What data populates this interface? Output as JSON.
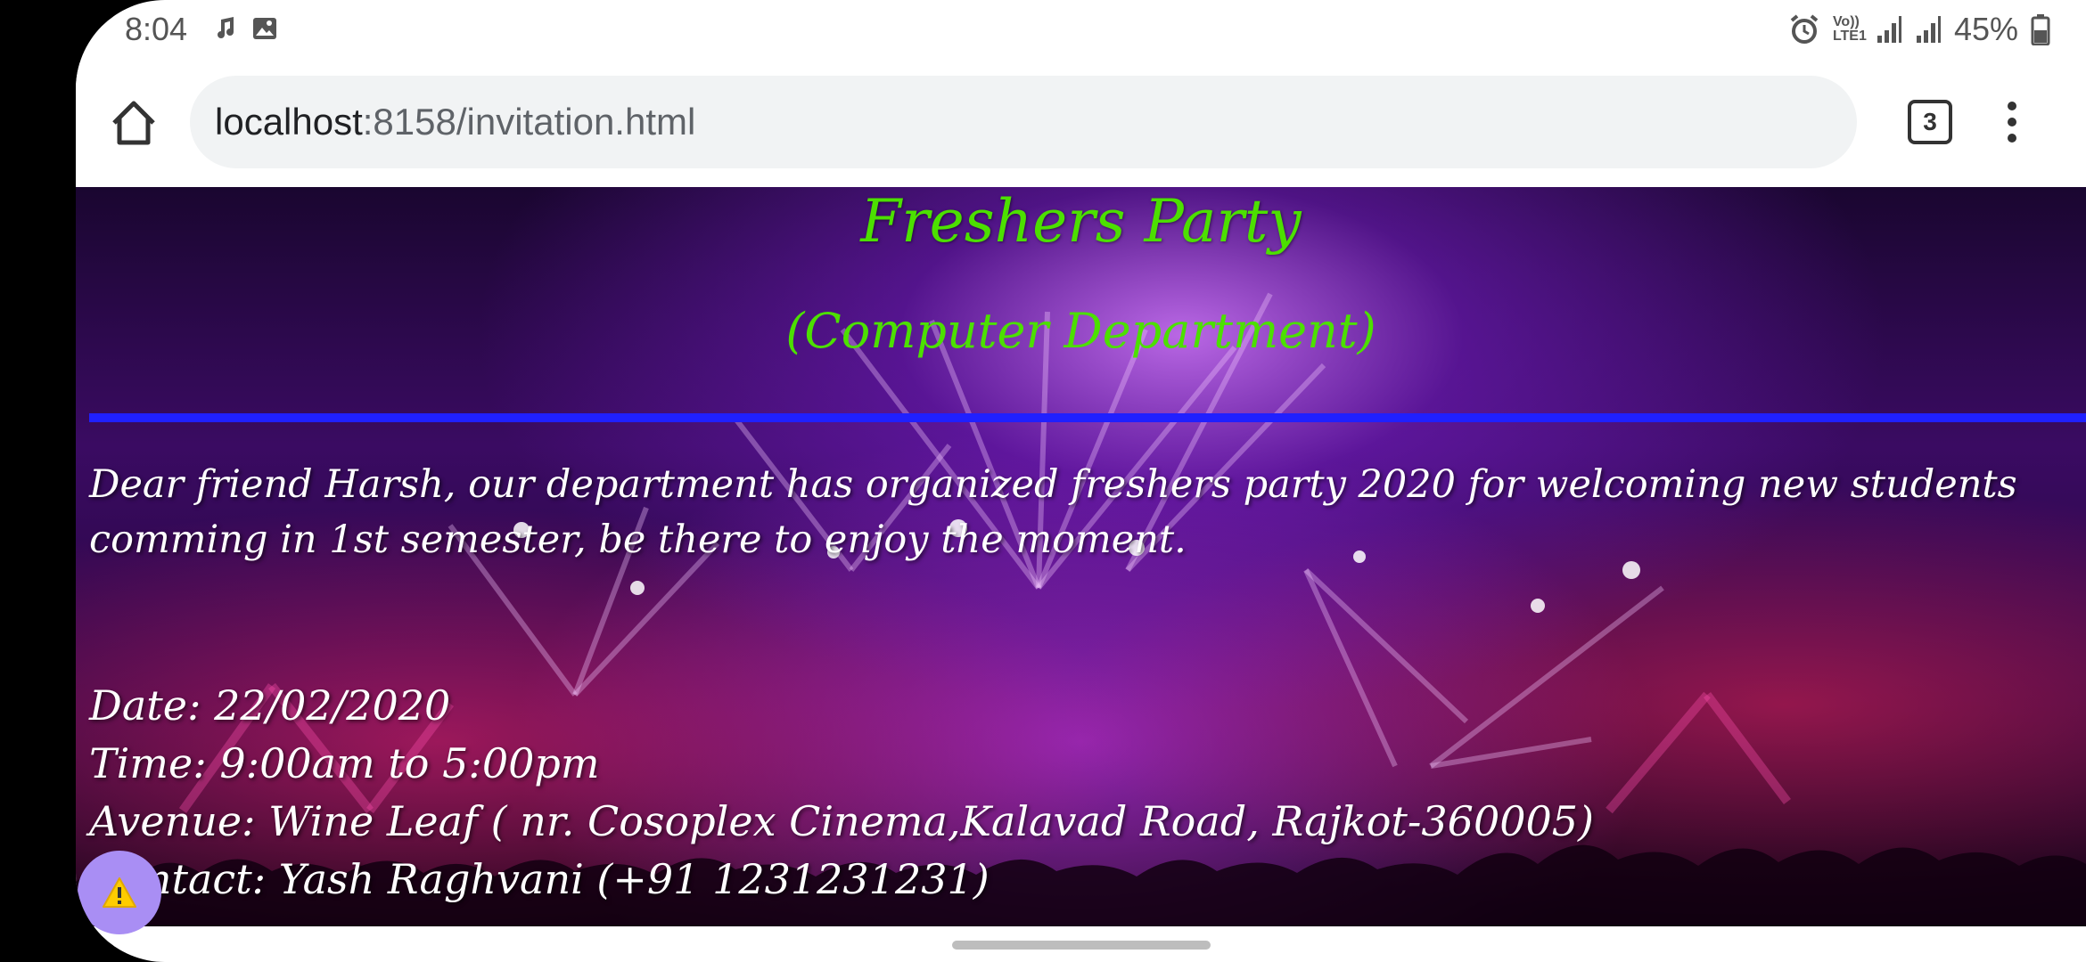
{
  "status_bar": {
    "time": "8:04",
    "left_icons": [
      "music-note-icon",
      "image-icon"
    ],
    "right_icons": [
      "alarm-icon",
      "volte-icon",
      "signal-icon",
      "signal-icon",
      "battery-icon"
    ],
    "network_label": "Vo)) LTE1",
    "battery": "45%"
  },
  "browser": {
    "url_host": "localhost",
    "url_path": ":8158/invitation.html",
    "tab_count": "3",
    "home_icon": "home-icon",
    "menu_icon": "more-vertical-icon"
  },
  "invitation": {
    "title": "Freshers Party",
    "subtitle": "(Computer Department)",
    "message": "Dear friend Harsh, our department has organized freshers party 2020 for welcoming new students comming in 1st semester, be there to enjoy the moment.",
    "date": "Date: 22/02/2020",
    "time": "Time: 9:00am to 5:00pm",
    "avenue": "Avenue: Wine Leaf ( nr. Cosoplex Cinema,Kalavad Road, Rajkot-360005)",
    "contact": "Contact: Yash Raghvani (+91 1231231231)"
  },
  "colors": {
    "title": "#4ce000",
    "divider": "#2020ff",
    "text": "#ffffff",
    "warning_button": "#a98ef4"
  },
  "floating_button_icon": "warning-icon"
}
